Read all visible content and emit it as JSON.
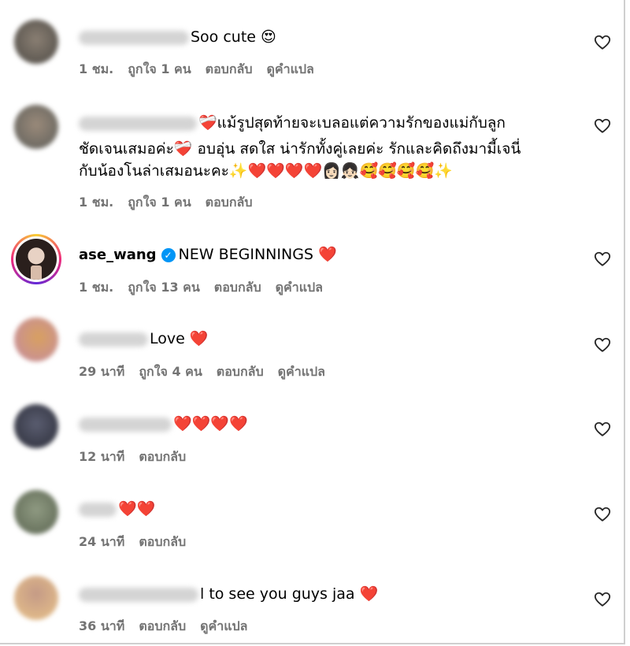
{
  "comments": [
    {
      "text": "Soo cute 😍",
      "meta": {
        "time": "1 ชม.",
        "likes": "ถูกใจ 1 คน",
        "reply": "ตอบกลับ",
        "translate": "ดูคำแปล"
      }
    },
    {
      "lines": [
        "❤️‍🩹แม้รูปสุดท้ายจะเบลอแต่ความรักของแม่กับลูก",
        "ชัดเจนเสมอค่ะ❤️‍🩹 อบอุ่น สดใส น่ารักทั้งคู่เลยค่ะ รักและคิดถึงมามี้เจนี่",
        "กับน้องโนล่าเสมอนะคะ✨❤️❤️❤️❤️👩🏻👧🏻🥰🥰🥰🥰✨"
      ],
      "meta": {
        "time": "1 ชม.",
        "likes": "ถูกใจ 1 คน",
        "reply": "ตอบกลับ"
      }
    },
    {
      "username": "ase_wang",
      "verified_mark": "✓",
      "text": "NEW BEGINNINGS ❤️",
      "meta": {
        "time": "1 ชม.",
        "likes": "ถูกใจ 13 คน",
        "reply": "ตอบกลับ",
        "translate": "ดูคำแปล"
      }
    },
    {
      "text": "Love ❤️",
      "meta": {
        "time": "29 นาที",
        "likes": "ถูกใจ 4 คน",
        "reply": "ตอบกลับ",
        "translate": "ดูคำแปล"
      }
    },
    {
      "text": "❤️❤️❤️❤️",
      "meta": {
        "time": "12 นาที",
        "reply": "ตอบกลับ"
      }
    },
    {
      "text": "❤️❤️",
      "meta": {
        "time": "24 นาที",
        "reply": "ตอบกลับ"
      }
    },
    {
      "text": "l to see you guys jaa ❤️",
      "meta": {
        "time": "36 นาที",
        "reply": "ตอบกลับ",
        "translate": "ดูคำแปล"
      }
    }
  ],
  "colors": {
    "meta_text": "#737373",
    "verified": "#0095f6",
    "heart_outline": "#262626"
  },
  "icons": {
    "like": "heart-outline-icon",
    "verified": "verified-badge-icon"
  }
}
